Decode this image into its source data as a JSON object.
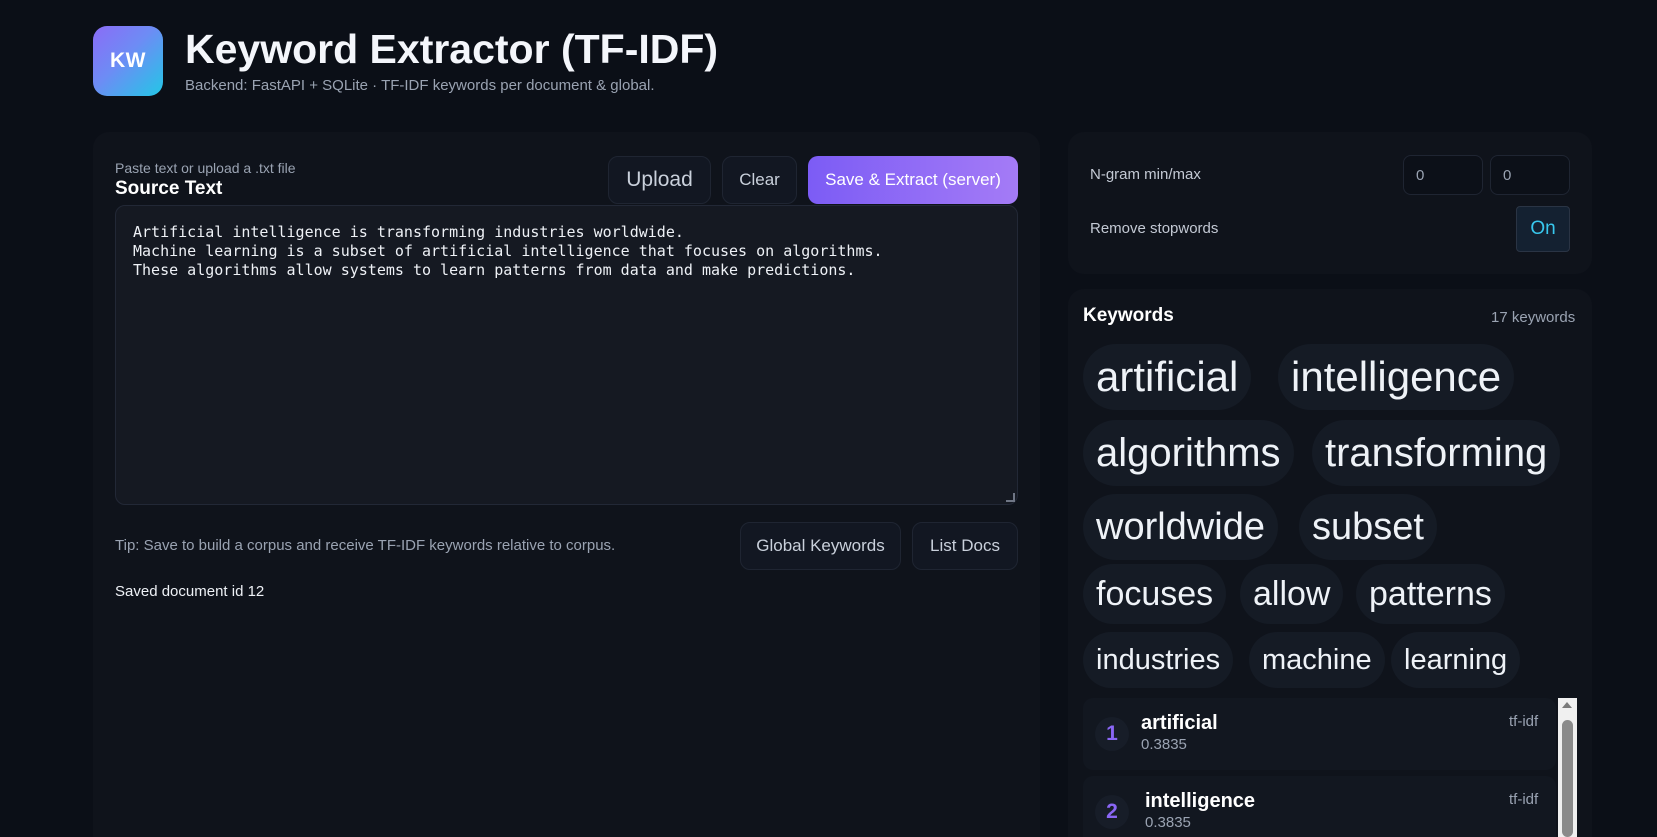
{
  "header": {
    "logo_text": "KW",
    "title": "Keyword Extractor (TF-IDF)",
    "subtitle": "Backend: FastAPI + SQLite · TF-IDF keywords per document & global."
  },
  "editor": {
    "small_label": "Paste text or upload a .txt file",
    "title": "Source Text",
    "upload_label": "Upload",
    "clear_label": "Clear",
    "save_label": "Save & Extract (server)",
    "text": "Artificial intelligence is transforming industries worldwide.\nMachine learning is a subset of artificial intelligence that focuses on algorithms.\nThese algorithms allow systems to learn patterns from data and make predictions.",
    "tip": "Tip: Save to build a corpus and receive TF-IDF keywords relative to corpus.",
    "global_label": "Global Keywords",
    "list_label": "List Docs",
    "status": "Saved document id 12"
  },
  "settings": {
    "ngram_label": "N-gram min/max",
    "ngram_min": "0",
    "ngram_max": "0",
    "stopwords_label": "Remove stopwords",
    "stopwords_toggle": "On"
  },
  "keywords": {
    "title": "Keywords",
    "count": "17 keywords",
    "chips": [
      "artificial",
      "intelligence",
      "algorithms",
      "transforming",
      "worldwide",
      "subset",
      "focuses",
      "allow",
      "patterns",
      "industries",
      "machine",
      "learning"
    ],
    "list": [
      {
        "rank": "1",
        "word": "artificial",
        "score": "0.3835",
        "method": "tf-idf"
      },
      {
        "rank": "2",
        "word": "intelligence",
        "score": "0.3835",
        "method": "tf-idf"
      }
    ]
  },
  "colors": {
    "background": "#0b0f17",
    "accent_purple": "#7c5cf5",
    "accent_cyan": "#22c7e6",
    "rank_color": "#8a66f5"
  }
}
